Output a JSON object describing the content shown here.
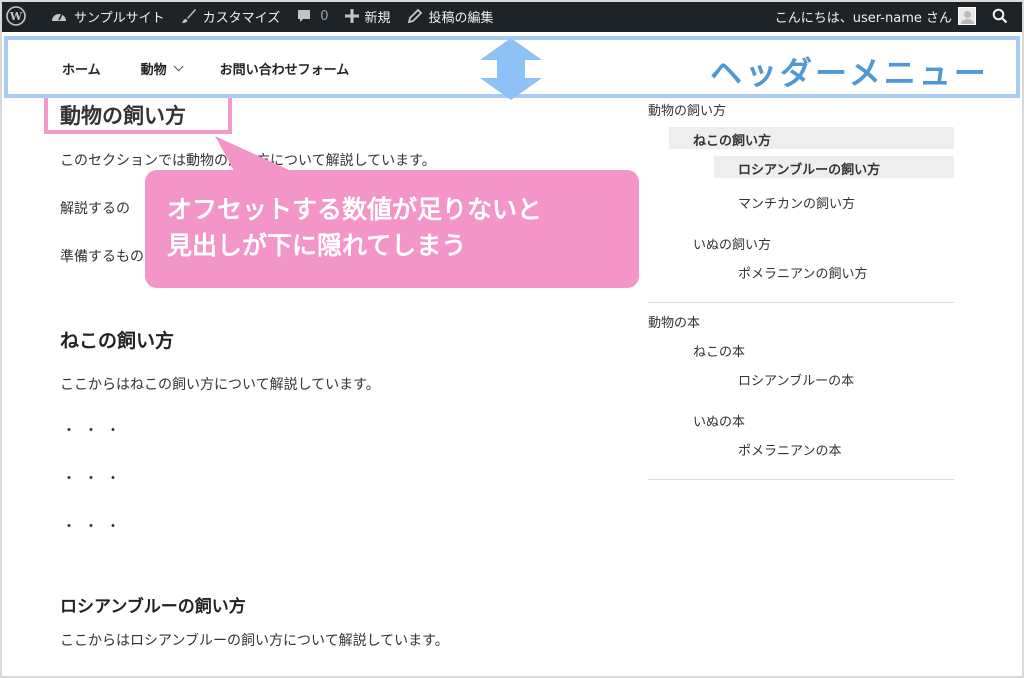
{
  "admin_bar": {
    "site_name": "サンプルサイト",
    "customize": "カスタマイズ",
    "comments_count": "0",
    "new": "新規",
    "edit_post": "投稿の編集",
    "greeting": "こんにちは、user-name さん"
  },
  "header": {
    "nav": [
      "ホーム",
      "動物",
      "お問い合わせフォーム"
    ],
    "annotation_label": "ヘッダーメニュー"
  },
  "content": {
    "heading_main": "動物の飼い方",
    "p1": "このセクションでは動物の飼い方について解説しています。",
    "p2": "解説するの",
    "p3": "準備するもの",
    "heading_cat": "ねこの飼い方",
    "p_cat": "ここからはねこの飼い方について解説しています。",
    "dots": [
      "・・・",
      "・・・",
      "・・・"
    ],
    "heading_russian_blue": "ロシアンブルーの飼い方",
    "p_russian_blue": "ここからはロシアンブルーの飼い方について解説しています。"
  },
  "callout": {
    "line1": "オフセットする数値が足りないと",
    "line2": "見出しが下に隠れてしまう"
  },
  "toc": {
    "group1": "動物の飼い方",
    "cat": "ねこの飼い方",
    "russian_blue": "ロシアンブルーの飼い方",
    "munchkin": "マンチカンの飼い方",
    "dog": "いぬの飼い方",
    "pomeranian": "ポメラニアンの飼い方",
    "group2": "動物の本",
    "cat_book": "ねこの本",
    "russian_blue_book": "ロシアンブルーの本",
    "dog_book": "いぬの本",
    "pomeranian_book": "ポメラニアンの本"
  },
  "colors": {
    "admin_bar_bg": "#1d2327",
    "header_outline": "#a9cbf2",
    "header_label": "#4f98d3",
    "callout_bg": "#f395c9",
    "heading_outline": "#f29bcb"
  }
}
